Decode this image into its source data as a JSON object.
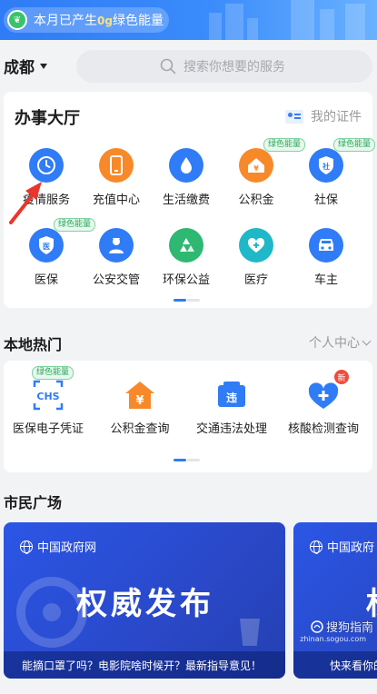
{
  "top_banner": {
    "prefix": "本月已产生",
    "amount": "0g",
    "suffix": "绿色能量",
    "leaf_icon": "leaf-icon"
  },
  "location": {
    "city": "成都"
  },
  "search": {
    "placeholder": "搜索你想要的服务"
  },
  "hall": {
    "title": "办事大厅",
    "my_cert": "我的证件",
    "services": [
      {
        "label": "疫情服务",
        "icon": "clock-icon",
        "color": "#2f7cf6",
        "badge": ""
      },
      {
        "label": "充值中心",
        "icon": "phone-icon",
        "color": "#f7892a",
        "badge": ""
      },
      {
        "label": "生活缴费",
        "icon": "drop-icon",
        "color": "#2f7cf6",
        "badge": ""
      },
      {
        "label": "公积金",
        "icon": "house-icon",
        "color": "#f7892a",
        "badge": "绿色能量"
      },
      {
        "label": "社保",
        "icon": "shield-icon",
        "color": "#2f7cf6",
        "badge": "绿色能量"
      },
      {
        "label": "医保",
        "icon": "medical-shield-icon",
        "color": "#2f7cf6",
        "badge": "绿色能量"
      },
      {
        "label": "公安交管",
        "icon": "police-icon",
        "color": "#2f7cf6",
        "badge": ""
      },
      {
        "label": "环保公益",
        "icon": "recycle-icon",
        "color": "#2eb872",
        "badge": ""
      },
      {
        "label": "医疗",
        "icon": "medical-kit-icon",
        "color": "#1fb8c8",
        "badge": ""
      },
      {
        "label": "车主",
        "icon": "car-icon",
        "color": "#2f7cf6",
        "badge": ""
      }
    ]
  },
  "local_hot": {
    "title": "本地热门",
    "personal_center": "个人中心",
    "items": [
      {
        "label": "医保电子凭证",
        "icon": "chs-icon",
        "badge": "绿色能量"
      },
      {
        "label": "公积金查询",
        "icon": "yuan-house-icon",
        "badge": ""
      },
      {
        "label": "交通违法处理",
        "icon": "violation-icon",
        "badge": ""
      },
      {
        "label": "核酸检测查询",
        "icon": "medical-plus-icon",
        "badge": "新"
      }
    ]
  },
  "citizen_square": {
    "title": "市民广场",
    "banner1": {
      "tag": "中国政府网",
      "title": "权威发布",
      "caption": "能摘口罩了吗？电影院啥时候开？最新指导意见！"
    },
    "banner2": {
      "tag": "中国政府",
      "title": "权",
      "caption": "快来看你的"
    }
  },
  "watermark": {
    "text": "搜狗指南",
    "sub": "zhinan.sogou.com"
  },
  "colors": {
    "primary": "#2f7cf6",
    "orange": "#f7892a",
    "green": "#2eb872",
    "teal": "#1fb8c8"
  }
}
